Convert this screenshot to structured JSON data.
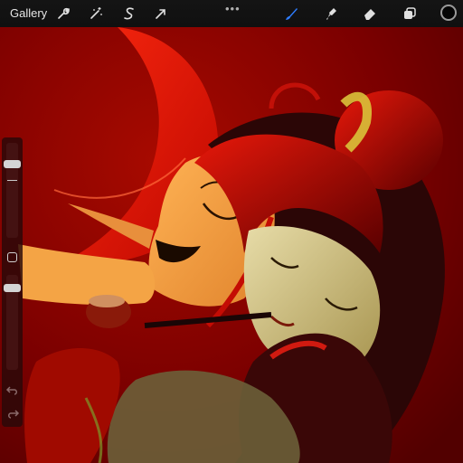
{
  "toolbar": {
    "gallery_label": "Gallery",
    "actions_icon": "wrench-icon",
    "adjustments_icon": "magic-wand-icon",
    "selection_icon": "selection-s-icon",
    "transform_icon": "arrow-cursor-icon",
    "more_icon": "ellipsis-icon",
    "brush_icon": "brush-icon",
    "smudge_icon": "smudge-icon",
    "eraser_icon": "eraser-icon",
    "layers_icon": "layers-icon",
    "active_color": "#050505",
    "active_tool_color": "#2e7dff"
  },
  "sidebar": {
    "brush_size_level": 0.2,
    "opacity_level": 0.1,
    "modify_icon": "square-modify-icon",
    "undo_icon": "undo-icon",
    "redo_icon": "redo-icon"
  },
  "artwork": {
    "description_colors": [
      "#7a0000",
      "#e01c0c",
      "#f2a14a",
      "#e8d9a0"
    ]
  }
}
